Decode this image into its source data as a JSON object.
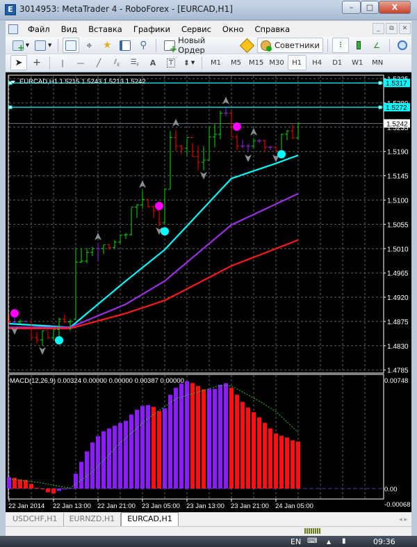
{
  "window": {
    "title": "3014953: MetaTrader 4 - RoboForex - [EURCAD,H1]",
    "minimize": "–",
    "maximize": "□",
    "close": "X"
  },
  "menu": [
    "Файл",
    "Вид",
    "Вставка",
    "Графики",
    "Сервис",
    "Окно",
    "Справка"
  ],
  "mdi_buttons": [
    "_",
    "⧉",
    "✕"
  ],
  "toolbar1": {
    "new_order": "Новый Ордер",
    "advisors": "Советники"
  },
  "toolbar2": {
    "timeframes": [
      "M1",
      "M5",
      "M15",
      "M30",
      "H1",
      "H4",
      "D1",
      "W1",
      "MN"
    ],
    "active_timeframe": "H1"
  },
  "chart": {
    "header": "EURCAD,H1  1.5215 1.5243 1.5213 1.5242",
    "price_labels": [
      "1.5325",
      "1.5280",
      "1.5235",
      "1.5190",
      "1.5145",
      "1.5100",
      "1.5055",
      "1.5010",
      "1.4965",
      "1.4920",
      "1.4875",
      "1.4830",
      "1.4785"
    ],
    "hlines": [
      {
        "price": 1.5317,
        "label": "1.5317",
        "color": "#00ffff"
      },
      {
        "price": 1.5272,
        "label": "1.5272",
        "color": "#00ffff"
      }
    ],
    "bid": {
      "price": 1.5242,
      "label": "1.5242"
    },
    "time_labels": [
      "22 Jan 2014",
      "22 Jan 13:00",
      "22 Jan 21:00",
      "23 Jan 05:00",
      "23 Jan 13:00",
      "23 Jan 21:00",
      "24 Jan 05:00"
    ],
    "colors": {
      "up": "#00e000",
      "down": "#ff0000",
      "doji": "#a020f0",
      "grid": "#5a6268"
    },
    "open": [
      1.4875,
      1.4874,
      1.4874,
      1.4875,
      1.4875,
      1.4845,
      1.4841,
      1.4858,
      1.4845,
      1.486,
      1.4879,
      1.4874,
      1.4879,
      1.4985,
      1.4987,
      1.5003,
      1.501,
      1.501,
      1.5017,
      1.5012,
      1.5022,
      1.5035,
      1.5036,
      1.5087,
      1.5091,
      1.5101,
      1.5088,
      1.508,
      1.5058,
      1.512,
      1.5216,
      1.52,
      1.5196,
      1.5216,
      1.5181,
      1.517,
      1.5174,
      1.5217,
      1.5222,
      1.5261,
      1.5261,
      1.5217,
      1.52,
      1.52,
      1.52,
      1.521,
      1.521,
      1.5198,
      1.5198,
      1.5191,
      1.5222,
      1.5228,
      1.5215
    ],
    "high": [
      1.489,
      1.4884,
      1.4879,
      1.4877,
      1.4875,
      1.4856,
      1.4858,
      1.4856,
      1.486,
      1.4882,
      1.4888,
      1.4879,
      1.5011,
      1.5011,
      1.5011,
      1.5013,
      1.5021,
      1.5017,
      1.5019,
      1.5026,
      1.5036,
      1.5039,
      1.5086,
      1.5092,
      1.5118,
      1.5101,
      1.509,
      1.5079,
      1.5122,
      1.5228,
      1.523,
      1.5202,
      1.5215,
      1.5206,
      1.52,
      1.52,
      1.5236,
      1.5241,
      1.5266,
      1.5271,
      1.5264,
      1.5221,
      1.5211,
      1.5204,
      1.5215,
      1.5213,
      1.5211,
      1.52,
      1.5198,
      1.5223,
      1.523,
      1.5239,
      1.5243
    ],
    "low": [
      1.4869,
      1.4871,
      1.4871,
      1.4873,
      1.4843,
      1.4834,
      1.483,
      1.4843,
      1.4841,
      1.4839,
      1.4871,
      1.4858,
      1.4879,
      1.4983,
      1.4983,
      1.4996,
      1.4987,
      1.5,
      1.5008,
      1.5011,
      1.5019,
      1.5028,
      1.5034,
      1.5067,
      1.5084,
      1.5086,
      1.5067,
      1.5051,
      1.5056,
      1.512,
      1.5191,
      1.5185,
      1.5183,
      1.518,
      1.5155,
      1.5155,
      1.5174,
      1.5198,
      1.5213,
      1.5256,
      1.5217,
      1.5193,
      1.5196,
      1.5189,
      1.5196,
      1.5206,
      1.5189,
      1.5193,
      1.5189,
      1.5193,
      1.5211,
      1.5213,
      1.5213
    ],
    "close": [
      1.4874,
      1.4874,
      1.4875,
      1.4875,
      1.4845,
      1.4841,
      1.4858,
      1.4845,
      1.486,
      1.4879,
      1.4874,
      1.4875,
      1.4985,
      1.4987,
      1.5003,
      1.501,
      1.501,
      1.5017,
      1.5012,
      1.5022,
      1.5035,
      1.5036,
      1.5087,
      1.5091,
      1.5101,
      1.5088,
      1.508,
      1.5058,
      1.512,
      1.5216,
      1.52,
      1.5196,
      1.5216,
      1.5181,
      1.517,
      1.5174,
      1.5217,
      1.5222,
      1.5261,
      1.5261,
      1.5217,
      1.52,
      1.52,
      1.52,
      1.521,
      1.521,
      1.5198,
      1.5198,
      1.5191,
      1.5222,
      1.5228,
      1.5215,
      1.5242
    ],
    "moving_averages": [
      {
        "color": "#00ffff",
        "points": [
          [
            0,
            1.4871
          ],
          [
            11,
            1.4864
          ],
          [
            21,
            1.495
          ],
          [
            28,
            1.5008
          ],
          [
            40,
            1.514
          ],
          [
            48,
            1.5168
          ],
          [
            52,
            1.5183
          ]
        ]
      },
      {
        "color": "#9b30e0",
        "points": [
          [
            0,
            1.4864
          ],
          [
            11,
            1.4864
          ],
          [
            21,
            1.4907
          ],
          [
            28,
            1.495
          ],
          [
            40,
            1.5054
          ],
          [
            52,
            1.5112
          ]
        ]
      },
      {
        "color": "#ff1a1a",
        "points": [
          [
            0,
            1.4862
          ],
          [
            11,
            1.4862
          ],
          [
            21,
            1.489
          ],
          [
            28,
            1.4914
          ],
          [
            40,
            1.4978
          ],
          [
            52,
            1.5026
          ]
        ]
      }
    ],
    "dots": [
      {
        "bar": 1,
        "price": 1.489,
        "color": "#ff00ff"
      },
      {
        "bar": 27,
        "price": 1.5089,
        "color": "#ff00ff"
      },
      {
        "bar": 41,
        "price": 1.5236,
        "color": "#ff00ff"
      },
      {
        "bar": 9,
        "price": 1.484,
        "color": "#00ffff"
      },
      {
        "bar": 28,
        "price": 1.5042,
        "color": "#00ffff"
      },
      {
        "bar": 49,
        "price": 1.5185,
        "color": "#00ffff"
      }
    ],
    "up_arrows": [
      {
        "bar": 16,
        "price": 1.5032
      },
      {
        "bar": 24,
        "price": 1.5129
      },
      {
        "bar": 30,
        "price": 1.5243
      },
      {
        "bar": 39,
        "price": 1.5284
      },
      {
        "bar": 44,
        "price": 1.5226
      }
    ],
    "down_arrows": [
      {
        "bar": 1,
        "price": 1.4858
      },
      {
        "bar": 6,
        "price": 1.4821
      },
      {
        "bar": 27,
        "price": 1.5043
      },
      {
        "bar": 35,
        "price": 1.5146
      },
      {
        "bar": 43,
        "price": 1.5178
      },
      {
        "bar": 48,
        "price": 1.5178
      }
    ]
  },
  "macd": {
    "header": "MACD(12,26,9) 0.00324 0.00000 0.00000 0.00387 0.00000",
    "labels": {
      "max": "0.00748",
      "zero": "0.00",
      "min": "-0.00068"
    },
    "ylim": [
      -0.00068,
      0.00748
    ],
    "colors": {
      "rising": "#8a1cff",
      "falling": "#ff1010",
      "signal": "#22cc22"
    },
    "histogram": [
      0.00078,
      0.00074,
      0.00062,
      0.00059,
      0.00032,
      5e-05,
      -5e-05,
      -0.00026,
      -0.00034,
      -0.00016,
      -5e-05,
      3e-05,
      0.00102,
      0.00184,
      0.00256,
      0.00318,
      0.00361,
      0.00395,
      0.00414,
      0.00433,
      0.00452,
      0.00467,
      0.0051,
      0.00543,
      0.00569,
      0.00575,
      0.00563,
      0.00534,
      0.00553,
      0.00646,
      0.00694,
      0.00723,
      0.0074,
      0.00727,
      0.00707,
      0.00683,
      0.00686,
      0.00687,
      0.00715,
      0.00726,
      0.00694,
      0.00646,
      0.00597,
      0.00558,
      0.00526,
      0.00491,
      0.00453,
      0.00414,
      0.00379,
      0.00363,
      0.00352,
      0.00332,
      0.00324
    ],
    "signal": [
      [
        0,
        0.00067
      ],
      [
        5,
        0.00043
      ],
      [
        11,
        3e-05
      ],
      [
        15,
        0.00115
      ],
      [
        20,
        0.00315
      ],
      [
        25,
        0.00483
      ],
      [
        30,
        0.00619
      ],
      [
        38,
        0.0071
      ],
      [
        40,
        0.00707
      ],
      [
        45,
        0.00603
      ],
      [
        48,
        0.00531
      ],
      [
        52,
        0.00387
      ]
    ]
  },
  "tabs": [
    {
      "label": "USDCHF,H1"
    },
    {
      "label": "EURNZD,H1"
    },
    {
      "label": "EURCAD,H1",
      "active": true
    }
  ],
  "taskbar": {
    "lang": "EN",
    "clock": "09:36"
  }
}
